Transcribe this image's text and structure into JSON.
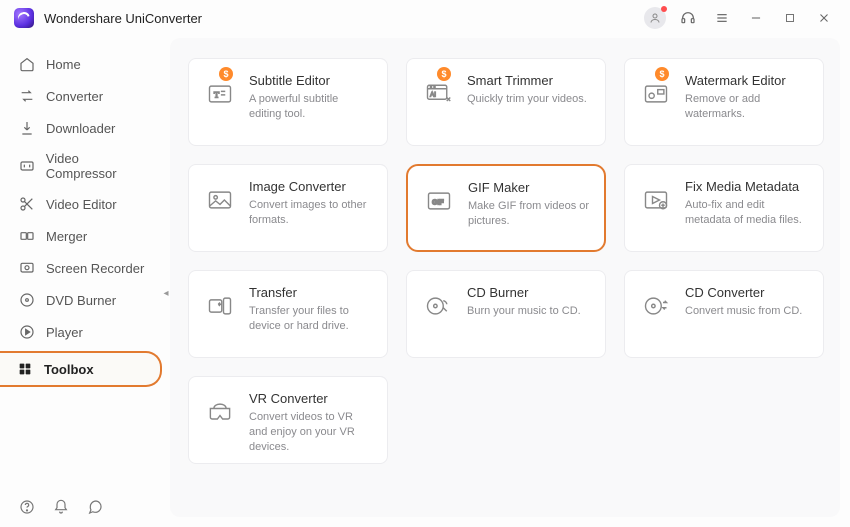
{
  "app": {
    "title": "Wondershare UniConverter"
  },
  "sidebar": {
    "items": [
      {
        "label": "Home"
      },
      {
        "label": "Converter"
      },
      {
        "label": "Downloader"
      },
      {
        "label": "Video Compressor"
      },
      {
        "label": "Video Editor"
      },
      {
        "label": "Merger"
      },
      {
        "label": "Screen Recorder"
      },
      {
        "label": "DVD Burner"
      },
      {
        "label": "Player"
      },
      {
        "label": "Toolbox"
      }
    ]
  },
  "tools": [
    {
      "title": "Subtitle Editor",
      "desc": "A powerful subtitle editing tool.",
      "badge": "$"
    },
    {
      "title": "Smart Trimmer",
      "desc": "Quickly trim your videos.",
      "badge": "$"
    },
    {
      "title": "Watermark Editor",
      "desc": "Remove or add watermarks.",
      "badge": "$"
    },
    {
      "title": "Image Converter",
      "desc": "Convert images to other formats.",
      "badge": null
    },
    {
      "title": "GIF Maker",
      "desc": "Make GIF from videos or pictures.",
      "badge": null
    },
    {
      "title": "Fix Media Metadata",
      "desc": "Auto-fix and edit metadata of media files.",
      "badge": null
    },
    {
      "title": "Transfer",
      "desc": "Transfer your files to device or hard drive.",
      "badge": null
    },
    {
      "title": "CD Burner",
      "desc": "Burn your music to CD.",
      "badge": null
    },
    {
      "title": "CD Converter",
      "desc": "Convert music from CD.",
      "badge": null
    },
    {
      "title": "VR Converter",
      "desc": "Convert videos to VR and enjoy on your VR devices.",
      "badge": null
    }
  ]
}
